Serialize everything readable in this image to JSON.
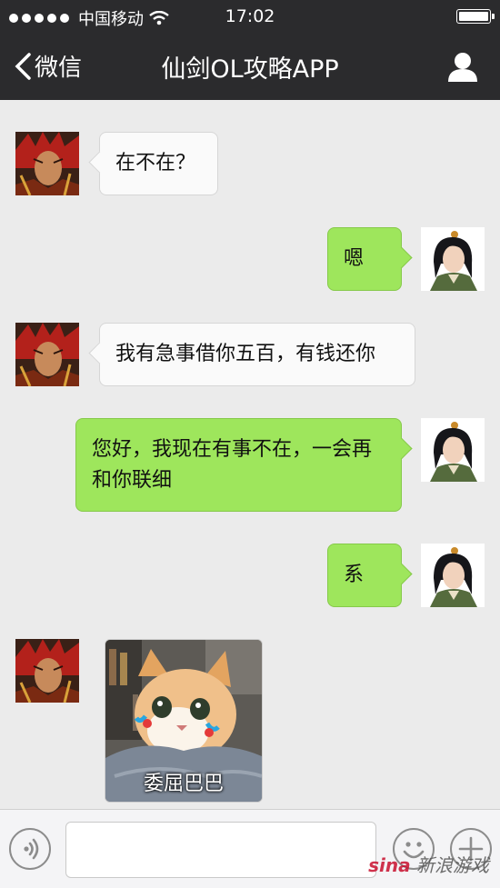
{
  "status_bar": {
    "carrier": "中国移动",
    "time": "17:02"
  },
  "nav": {
    "back_label": "微信",
    "title": "仙剑OL攻略APP"
  },
  "messages": [
    {
      "side": "left",
      "text": "在不在？"
    },
    {
      "side": "right",
      "text": "嗯"
    },
    {
      "side": "left",
      "text": "我有急事借你五百，有钱还你"
    },
    {
      "side": "right",
      "text": "您好，我现在有事不在，一会再和你联细"
    },
    {
      "side": "right",
      "text": "系"
    },
    {
      "side": "left",
      "sticker_caption": "委屈巴巴"
    }
  ],
  "watermark": {
    "brand": "sina",
    "text": "新浪游戏"
  },
  "colors": {
    "nav_bg": "#2b2b2d",
    "my_bubble": "#9ee65c",
    "their_bubble": "#fafafa",
    "chat_bg": "#ebebeb"
  }
}
